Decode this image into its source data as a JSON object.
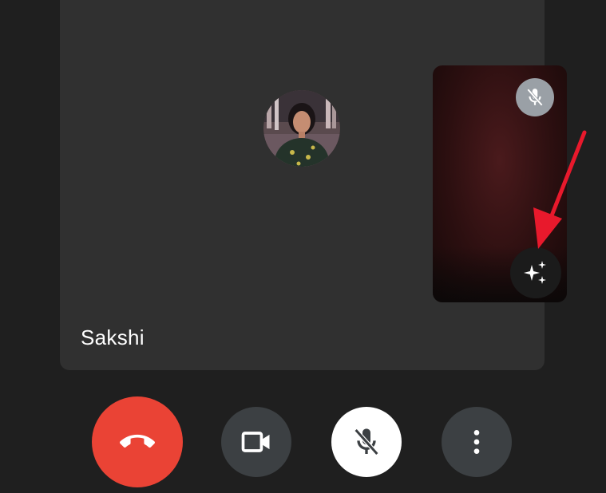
{
  "participant": {
    "name": "Sakshi",
    "avatar_icon": "participant-avatar"
  },
  "self_view": {
    "mute_badge_icon": "mic-off-icon",
    "effects_icon": "sparkle-effects-icon"
  },
  "controls": {
    "end_call_icon": "phone-hangup-icon",
    "camera_icon": "video-camera-icon",
    "mic_icon": "mic-off-icon",
    "more_icon": "more-vertical-icon"
  },
  "colors": {
    "end_call": "#ea4335",
    "annotation_arrow": "#e8192c",
    "control_dark": "#3c4043",
    "background": "#1f1f1f"
  }
}
